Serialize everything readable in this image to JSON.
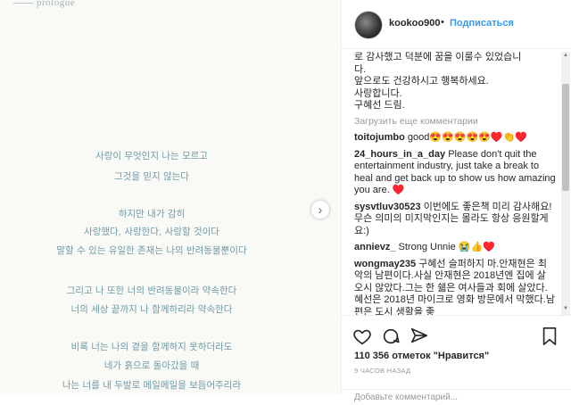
{
  "post_image": {
    "prologue_label": "prologue",
    "poem_lines": [
      "사랑이 무엇인지 나는 모르고",
      "그것을 믿지 않는다",
      "하지만 내가 감히",
      "사랑했다, 사랑한다, 사랑할 것이다",
      "말할 수 있는 유일한 존재는 나의 반려동물뿐이다",
      "그리고 나 또한 너의 반려동물이라 약속한다",
      "너의 세상 끝까지 나 함께하리라 약속한다",
      "비록 너는 나의 곁을 함께하지 못하더라도",
      "네가 흙으로 돌아갔을 때",
      "나는 너를 내 두발로 메일메일을 보듬어주리라"
    ]
  },
  "header": {
    "username": "kookoo900",
    "separator": "•",
    "follow_label": "Подписаться"
  },
  "comments": {
    "caption_lines": [
      "로 감사했고 덕분에 꿈을 이룰수 있었습니",
      "다.",
      "앞으로도 건강하시고 행복하세요.",
      "사랑합니다.",
      "구혜선 드림."
    ],
    "load_more": "Загрузить еще комментарии",
    "items": [
      {
        "user": "toitojumbo",
        "text": "good😍😍😍😍😍♥️👏♥️"
      },
      {
        "user": "24_hours_in_a_day",
        "text": "Please don't quit the entertainment industry, just take a break to heal and get back up to show us how amazing you are. ♥️"
      },
      {
        "user": "sysvtluv30523",
        "text": "이번에도 좋은책 미리 감사해요! 무슨 의미의 미지막인지는 몰라도 항상 응원할게요:)"
      },
      {
        "user": "annievz_",
        "text": "Strong Unnie 😭👍♥️"
      },
      {
        "user": "wongmay235",
        "text": "구혜선 슬퍼하지 마.안재현은 최악의 남편이다.사실 안재현은 2018년엔 집에 살 오시 않았다.그는 한 쉛은 여사들과 회에 살았다.혜선은 2018년 마이크로 영화 방문에서 막했다.남편은 도시 생활을 좋"
      }
    ]
  },
  "actions": {
    "likes": "110 356 отметок \"Нравится\"",
    "time": "9 ЧАСОВ НАЗАД",
    "add_comment_placeholder": "Добавьте комментарий..."
  }
}
